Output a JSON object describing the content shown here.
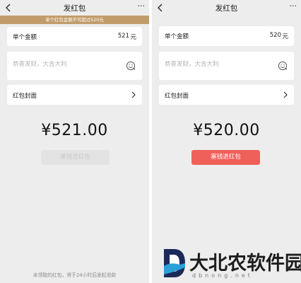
{
  "screens": [
    {
      "nav": {
        "title": "发红包",
        "more": "···"
      },
      "warning": "单个红包金额不可超过520元",
      "amount": {
        "label": "单个金额",
        "value": "521",
        "unit": "元"
      },
      "greeting": {
        "placeholder": "恭喜发财，大吉大利"
      },
      "cover": {
        "label": "红包封面"
      },
      "total": "¥521.00",
      "send_button": "塞钱进红包",
      "send_enabled": false,
      "footer": "未领取的红包，将于24小时后发起退款"
    },
    {
      "nav": {
        "title": "发红包",
        "more": "···"
      },
      "amount": {
        "label": "单个金额",
        "value": "520",
        "unit": "元"
      },
      "greeting": {
        "placeholder": "恭喜发财，大吉大利"
      },
      "cover": {
        "label": "红包封面"
      },
      "total": "¥520.00",
      "send_button": "塞钱进红包",
      "send_enabled": true
    }
  ],
  "watermark": {
    "name": "大北农软件园",
    "url": "dbnong.net"
  },
  "colors": {
    "background": "#ededed",
    "warning_bar": "#c19c6a",
    "send_enabled": "#f0605a",
    "send_disabled": "#e3e3e3"
  },
  "icons": [
    "back-icon",
    "more-icon",
    "emoji-icon",
    "chevron-right-icon"
  ]
}
